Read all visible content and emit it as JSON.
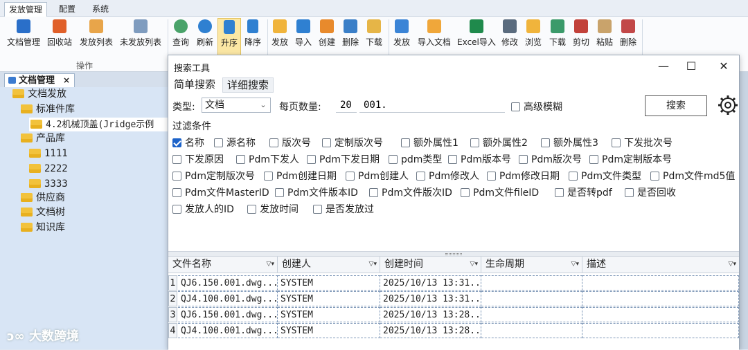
{
  "menu": {
    "tabs": [
      "发放管理",
      "配置",
      "系统"
    ]
  },
  "ribbon": {
    "buttons": [
      "文档管理",
      "回收站",
      "发放列表",
      "未发放列表",
      "查询",
      "刷新",
      "升序",
      "降序",
      "发放",
      "导入",
      "创建",
      "删除",
      "下载",
      "发放",
      "导入文档",
      "Excel导入",
      "修改",
      "浏览",
      "下载",
      "剪切",
      "粘贴",
      "删除"
    ],
    "group_caption": "操作",
    "colors": {
      "accent": "#2f80d1",
      "pressed_bg": "#fbe7a4"
    }
  },
  "left_panel": {
    "tab_label": "文档管理",
    "tab_close": "×",
    "tree": [
      "文档发放",
      "标准件库",
      "4.2机械顶盖(Jridge示例",
      "产品库",
      "1111",
      "2222",
      "3333",
      "供应商",
      "文档树",
      "知识库"
    ],
    "watermark": "大数跨境"
  },
  "dialog": {
    "title": "搜索工具",
    "controls": {
      "minimize": "—",
      "maximize": "☐",
      "close": "✕"
    },
    "tabs": [
      "简单搜索",
      "详细搜索"
    ],
    "type_label": "类型:",
    "type_value": "文档",
    "page_size_label": "每页数量:",
    "page_size_value": "20",
    "keyword_value": "001.",
    "fuzzy_label": "高级模糊",
    "search_button": "搜索",
    "filter_title": "过滤条件",
    "filters": [
      {
        "label": "名称",
        "checked": true
      },
      {
        "label": "源名称",
        "checked": false
      },
      {
        "label": "版次号",
        "checked": false
      },
      {
        "label": "定制版次号",
        "checked": false
      },
      {
        "label": "额外属性1",
        "checked": false
      },
      {
        "label": "额外属性2",
        "checked": false
      },
      {
        "label": "额外属性3",
        "checked": false
      },
      {
        "label": "下发批次号",
        "checked": false
      },
      {
        "label": "下发原因",
        "checked": false
      },
      {
        "label": "Pdm下发人",
        "checked": false
      },
      {
        "label": "Pdm下发日期",
        "checked": false
      },
      {
        "label": "pdm类型",
        "checked": false
      },
      {
        "label": "Pdm版本号",
        "checked": false
      },
      {
        "label": "Pdm版次号",
        "checked": false
      },
      {
        "label": "Pdm定制版本号",
        "checked": false
      },
      {
        "label": "Pdm定制版次号",
        "checked": false
      },
      {
        "label": "Pdm创建日期",
        "checked": false
      },
      {
        "label": "Pdm创建人",
        "checked": false
      },
      {
        "label": "Pdm修改人",
        "checked": false
      },
      {
        "label": "Pdm修改日期",
        "checked": false
      },
      {
        "label": "Pdm文件类型",
        "checked": false
      },
      {
        "label": "Pdm文件md5值",
        "checked": false
      },
      {
        "label": "Pdm文件MasterID",
        "checked": false
      },
      {
        "label": "Pdm文件版本ID",
        "checked": false
      },
      {
        "label": "Pdm文件版次ID",
        "checked": false
      },
      {
        "label": "Pdm文件fileID",
        "checked": false
      },
      {
        "label": "是否转pdf",
        "checked": false
      },
      {
        "label": "是否回收",
        "checked": false
      },
      {
        "label": "发放人的ID",
        "checked": false
      },
      {
        "label": "发放时间",
        "checked": false
      },
      {
        "label": "是否发放过",
        "checked": false
      }
    ],
    "table": {
      "columns": [
        "文件名称",
        "创建人",
        "创建时间",
        "生命周期",
        "描述"
      ],
      "rows": [
        {
          "num": "1",
          "file": "QJ6.150.001.dwg...",
          "creator": "SYSTEM",
          "time": "2025/10/13 13:31...",
          "life": "",
          "desc": ""
        },
        {
          "num": "2",
          "file": "QJ4.100.001.dwg...",
          "creator": "SYSTEM",
          "time": "2025/10/13 13:31...",
          "life": "",
          "desc": ""
        },
        {
          "num": "3",
          "file": "QJ6.150.001.dwg...",
          "creator": "SYSTEM",
          "time": "2025/10/13 13:28...",
          "life": "",
          "desc": ""
        },
        {
          "num": "4",
          "file": "QJ4.100.001.dwg...",
          "creator": "SYSTEM",
          "time": "2025/10/13 13:28...",
          "life": "",
          "desc": ""
        }
      ]
    }
  }
}
